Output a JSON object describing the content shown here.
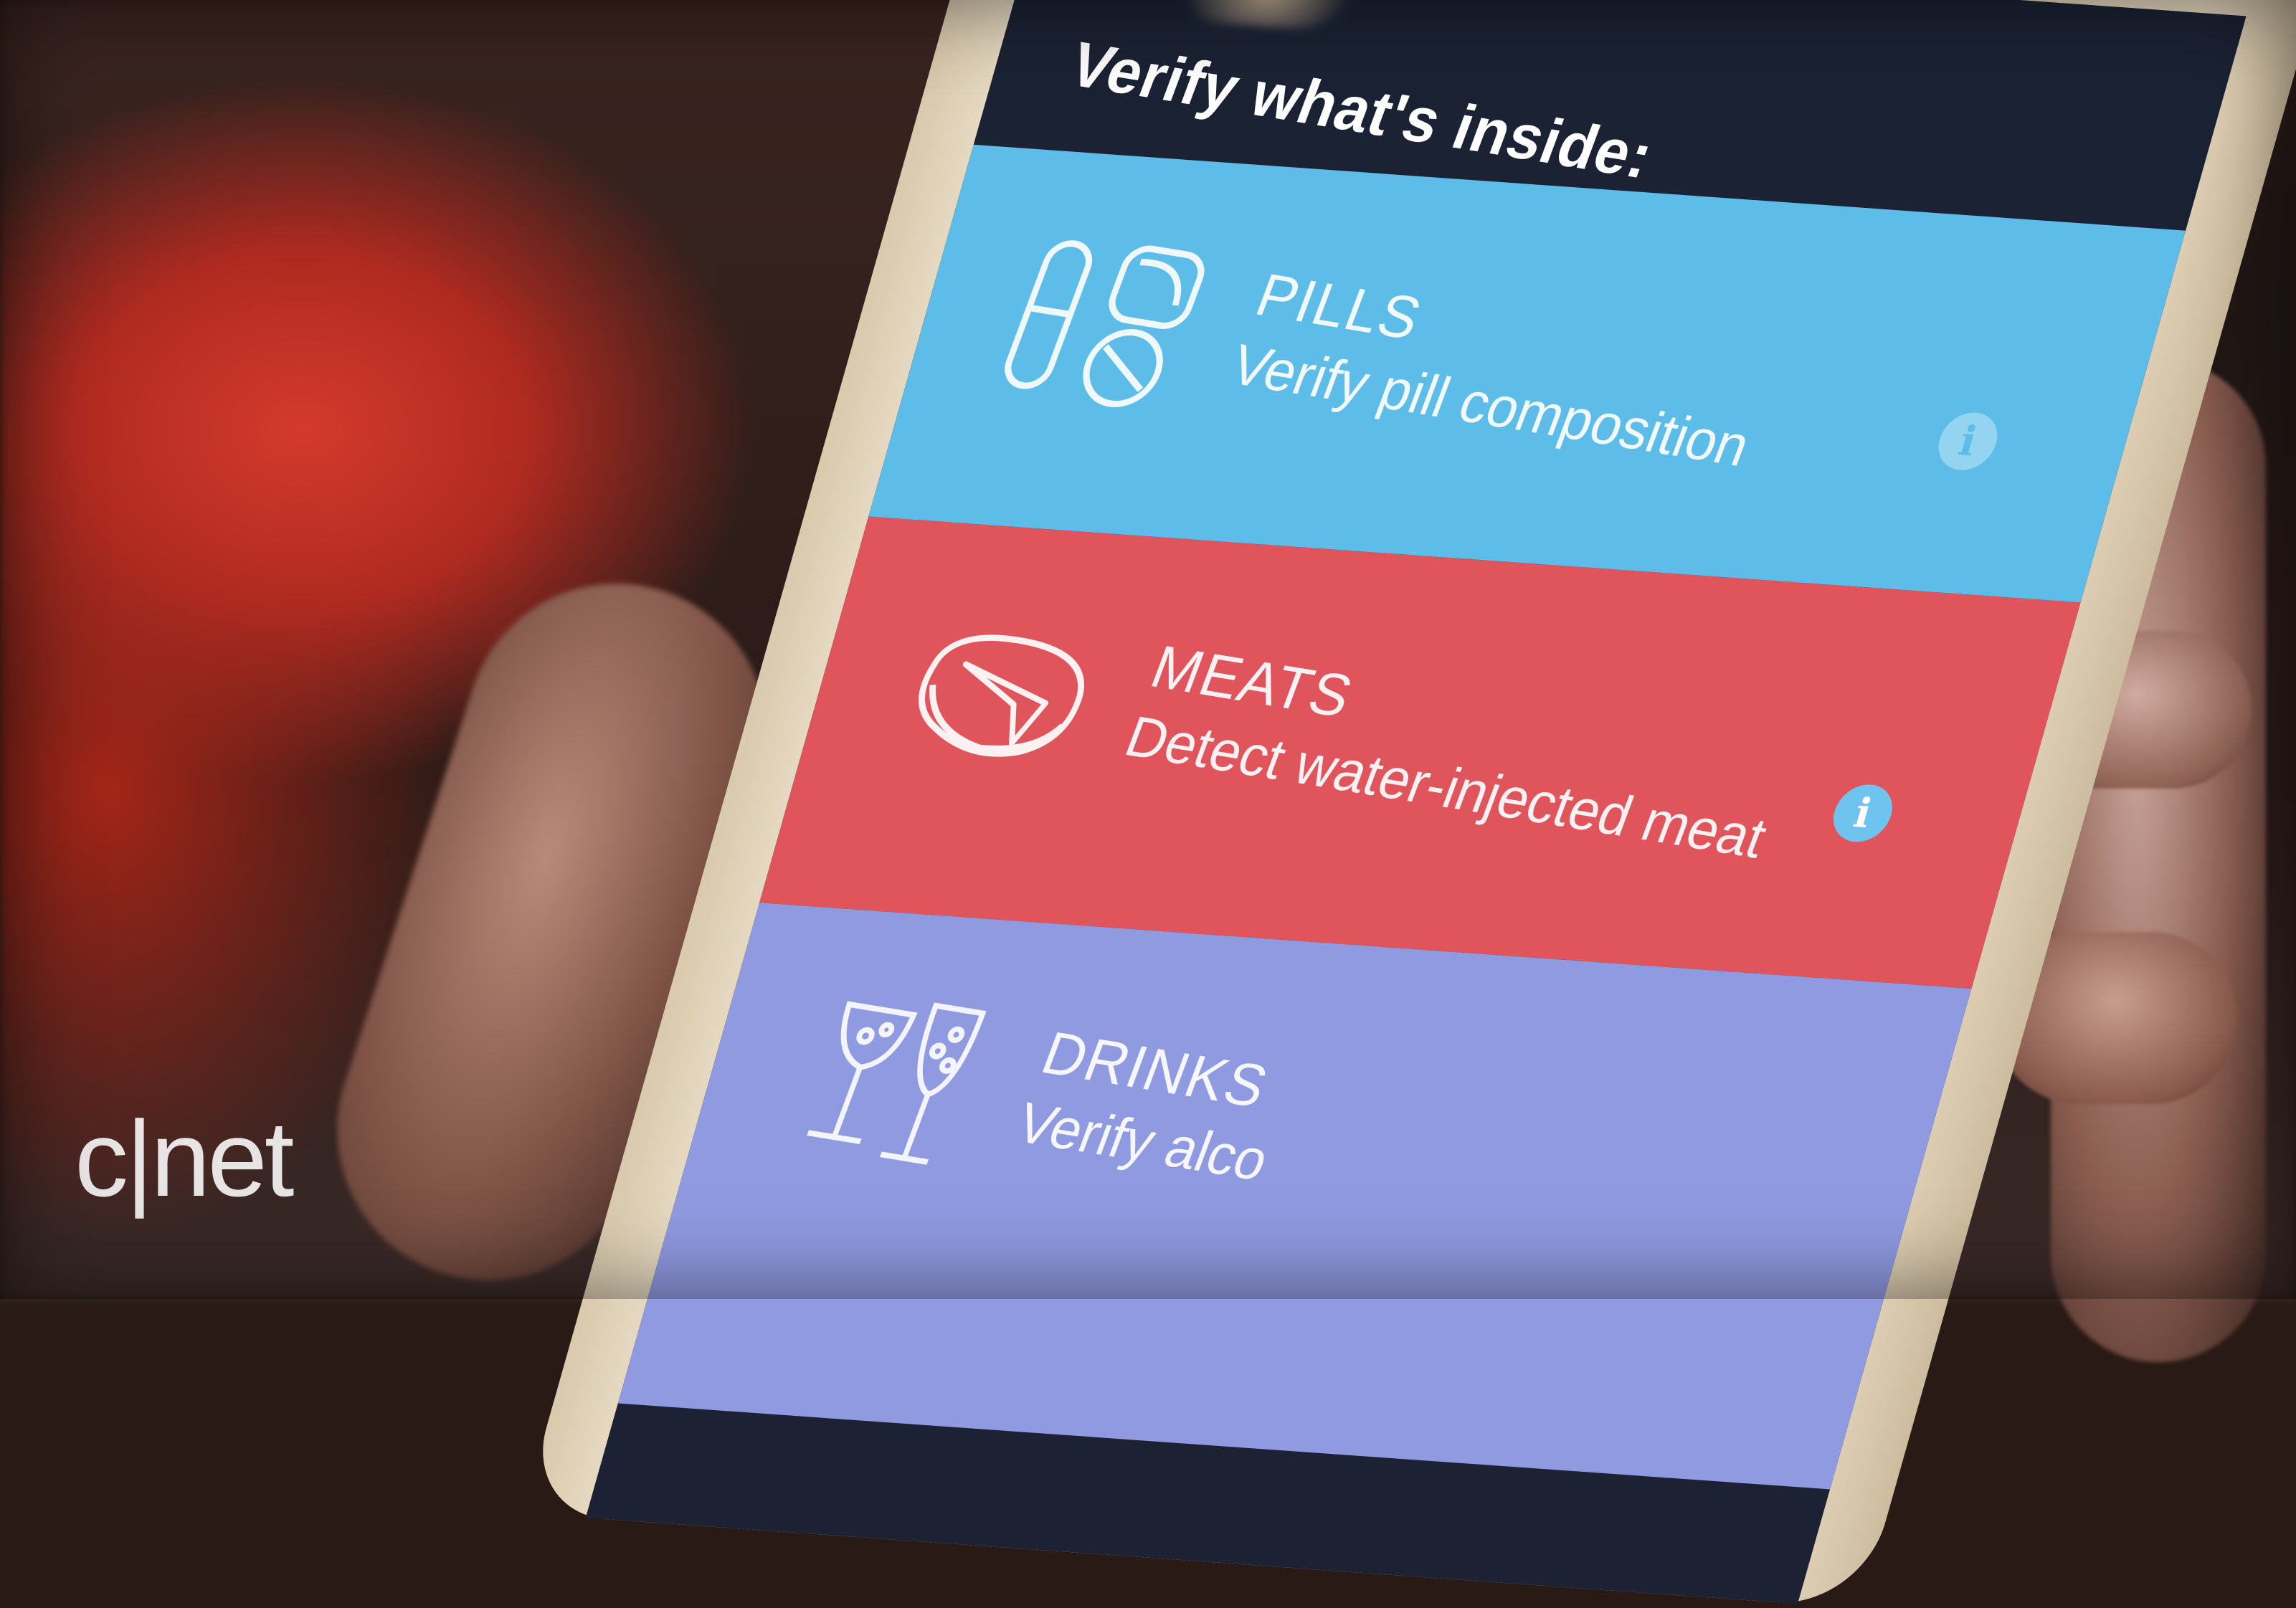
{
  "header": {
    "title": "Verify what's inside:"
  },
  "cards": [
    {
      "title": "PILLS",
      "description": "Verify pill composition",
      "icon": "pills-icon",
      "color": "#5dbde8"
    },
    {
      "title": "MEATS",
      "description": "Detect water-injected meat",
      "icon": "meat-icon",
      "color": "#e0555c"
    },
    {
      "title": "DRINKS",
      "description": "Verify alco",
      "icon": "drinks-icon",
      "color": "#8f9ae0"
    }
  ],
  "info_glyph": "i",
  "watermark": "c|net"
}
